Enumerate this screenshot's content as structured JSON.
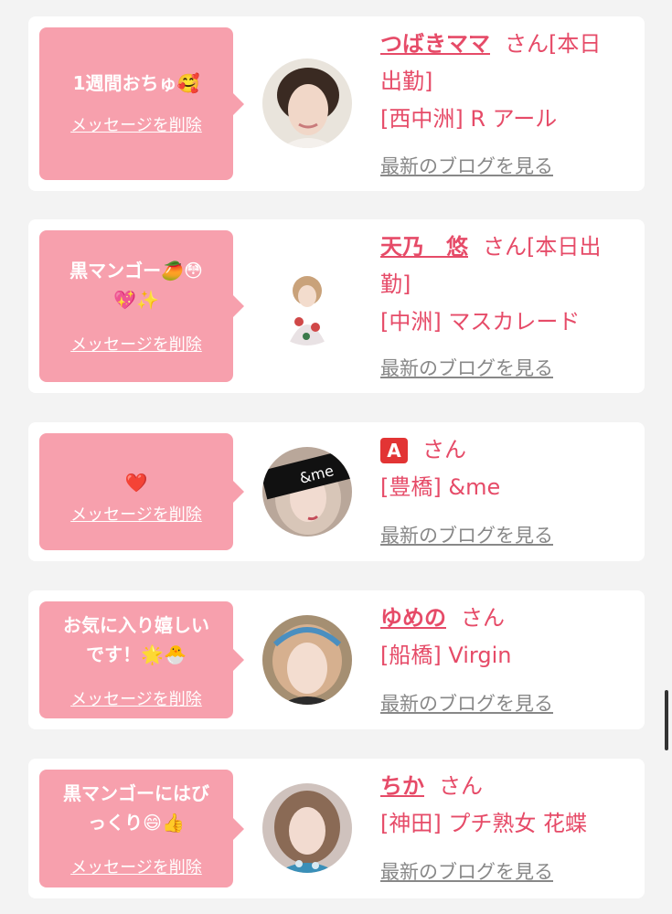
{
  "delete_label": "メッセージを削除",
  "blog_label": "最新のブログを見る",
  "san": "さん",
  "cards": [
    {
      "message_lines": [
        "1週間おちゅ🥰"
      ],
      "name": "つばきママ",
      "status_lines": [
        "さん[本日",
        "出勤]"
      ],
      "shop": "[西中洲] R アール"
    },
    {
      "message_lines": [
        "黒マンゴー🥭😳",
        "💖✨"
      ],
      "name": "天乃　悠",
      "status_lines": [
        "さん[本日出",
        "勤]"
      ],
      "shop": "[中洲] マスカレード"
    },
    {
      "message_lines": [
        "❤️"
      ],
      "name": "A",
      "status_lines": [
        "さん"
      ],
      "shop": "[豊橋] &me"
    },
    {
      "message_lines": [
        "お気に入り嬉しい",
        "です！🌟🐣"
      ],
      "name": "ゆめの",
      "status_lines": [
        "さん"
      ],
      "shop": "[船橋] Virgin"
    },
    {
      "message_lines": [
        "黒マンゴーにはび",
        "っくり😄👍"
      ],
      "name": "ちか",
      "status_lines": [
        "さん"
      ],
      "shop": "[神田] プチ熟女 花蝶"
    }
  ],
  "avatar_badge": "&me"
}
